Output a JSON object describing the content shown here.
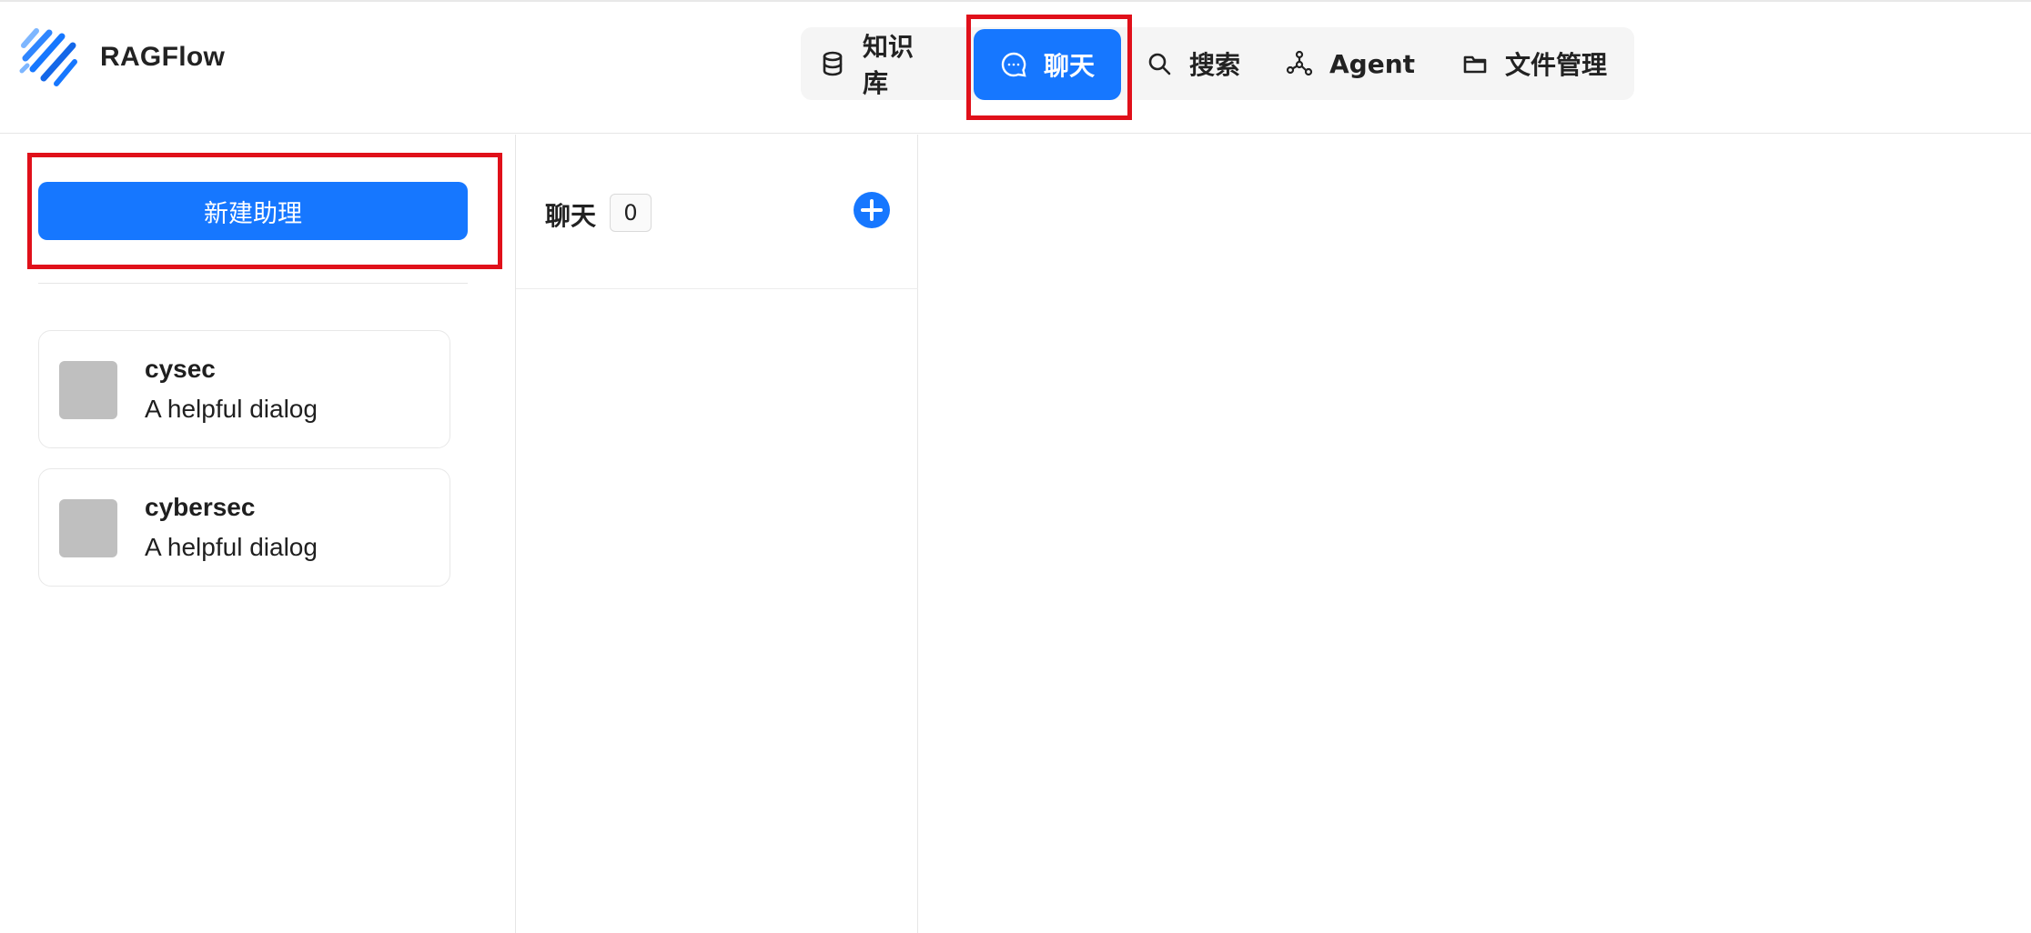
{
  "brand": {
    "name": "RAGFlow"
  },
  "nav": {
    "items": [
      {
        "label": "知识库",
        "icon": "database-icon"
      },
      {
        "label": "聊天",
        "icon": "chat-bubble-icon",
        "active": true
      },
      {
        "label": "搜索",
        "icon": "search-icon"
      },
      {
        "label": "Agent",
        "icon": "graph-nodes-icon"
      },
      {
        "label": "文件管理",
        "icon": "folder-icon"
      }
    ]
  },
  "sidebar": {
    "new_button_label": "新建助理",
    "assistants": [
      {
        "name": "cysec",
        "description": "A helpful dialog"
      },
      {
        "name": "cybersec",
        "description": "A helpful dialog"
      }
    ]
  },
  "chats": {
    "title": "聊天",
    "count": "0"
  },
  "colors": {
    "accent": "#1677ff",
    "highlight": "#e0101a",
    "avatar_placeholder": "#bfbfbf"
  }
}
